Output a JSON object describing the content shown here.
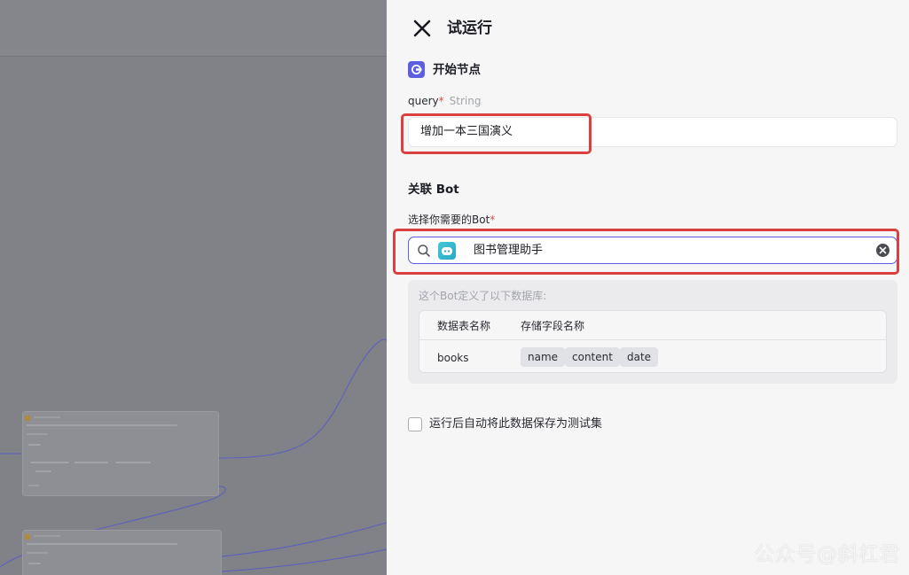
{
  "panel": {
    "title": "试运行",
    "start_node": {
      "title": "开始节点",
      "field": {
        "name": "query",
        "required_mark": "*",
        "type": "String",
        "value": "增加一本三国演义"
      }
    },
    "bot_section": {
      "title": "关联 Bot",
      "select_label": "选择你需要的Bot",
      "required_mark": "*",
      "selected_bot": "图书管理助手",
      "db_caption": "这个Bot定义了以下数据库:",
      "table_headers": [
        "数据表名称",
        "存储字段名称"
      ],
      "tables": [
        {
          "name": "books",
          "fields": [
            "name",
            "content",
            "date"
          ]
        }
      ]
    },
    "save_option": {
      "label": "运行后自动将此数据保存为测试集",
      "checked": false
    }
  },
  "watermark": "公众号@斜杠君",
  "colors": {
    "accent": "#5b5fe0",
    "highlight": "#d9403f",
    "required": "#e04848"
  },
  "icons": [
    "close-icon",
    "start-node-icon",
    "search-icon",
    "bot-avatar-icon",
    "clear-icon"
  ]
}
